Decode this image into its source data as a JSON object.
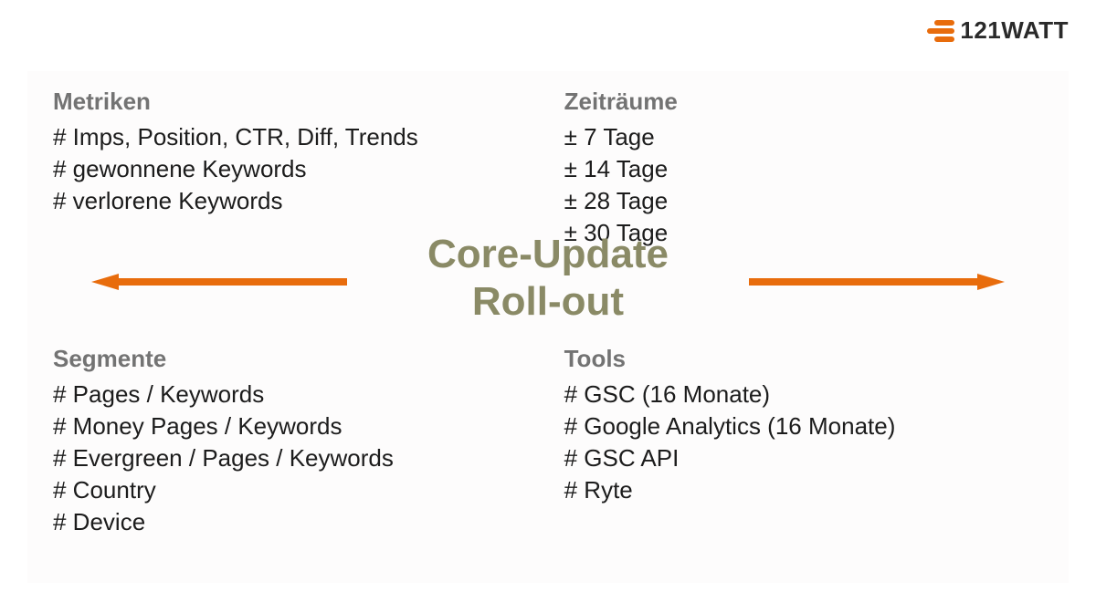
{
  "brand": {
    "name": "121WATT"
  },
  "center": {
    "line1": "Core-Update",
    "line2": "Roll-out"
  },
  "quadrants": {
    "metriken": {
      "title": "Metriken",
      "items": [
        "# Imps, Position, CTR, Diff, Trends",
        "# gewonnene Keywords",
        "# verlorene Keywords"
      ]
    },
    "zeitraeume": {
      "title": "Zeiträume",
      "items": [
        "± 7 Tage",
        "± 14 Tage",
        "± 28 Tage",
        "± 30 Tage"
      ]
    },
    "segmente": {
      "title": "Segmente",
      "items": [
        "# Pages / Keywords",
        "# Money Pages / Keywords",
        "# Evergreen / Pages / Keywords",
        "# Country",
        "# Device"
      ]
    },
    "tools": {
      "title": "Tools",
      "items": [
        "# GSC (16 Monate)",
        "# Google Analytics (16 Monate)",
        "# GSC API",
        "# Ryte"
      ]
    }
  },
  "colors": {
    "orange": "#e86c0c",
    "olive": "#8a8a66",
    "heading": "#737373",
    "text": "#1c1c1c"
  }
}
